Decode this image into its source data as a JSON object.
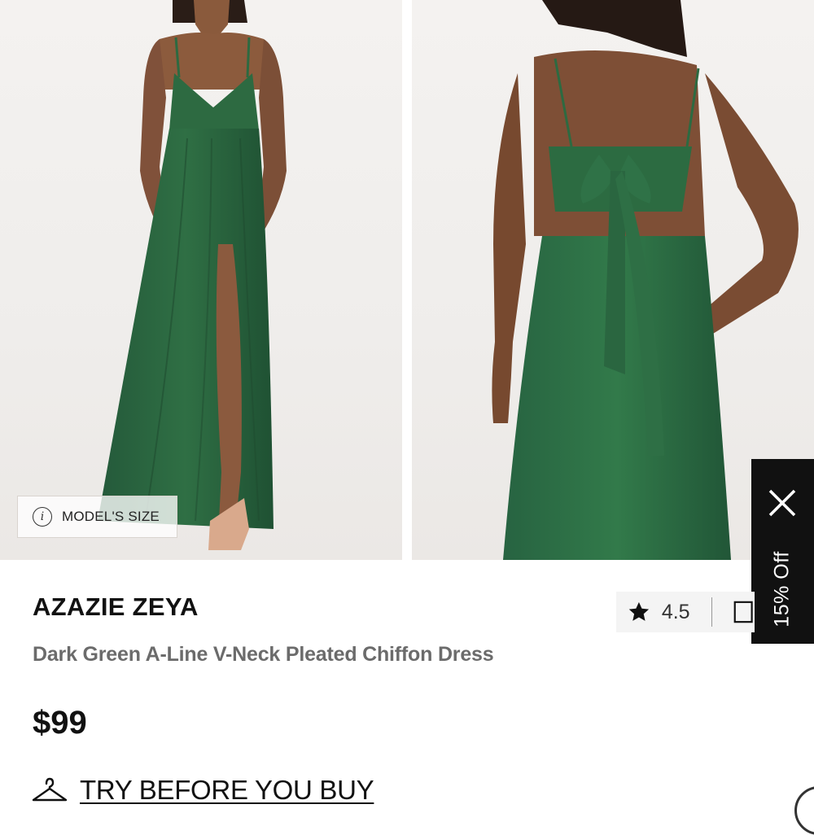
{
  "gallery": {
    "front_image_alt": "model-front-view",
    "back_image_alt": "model-back-view",
    "model_size_label": "MODEL'S SIZE",
    "info_icon_glyph": "i",
    "dress_color": "#2f6b3f"
  },
  "promo": {
    "label": "15% Off",
    "close_icon": "close-icon",
    "background": "#111111"
  },
  "product": {
    "brand": "AZAZIE ZEYA",
    "title": "Dark Green A-Line V-Neck Pleated Chiffon Dress",
    "price": "$99",
    "rating": "4.5",
    "rating_icon": "star-icon",
    "reviews_icon": "photo-review-icon"
  },
  "try_before": {
    "label": "TRY BEFORE YOU BUY",
    "icon": "hanger-icon"
  }
}
